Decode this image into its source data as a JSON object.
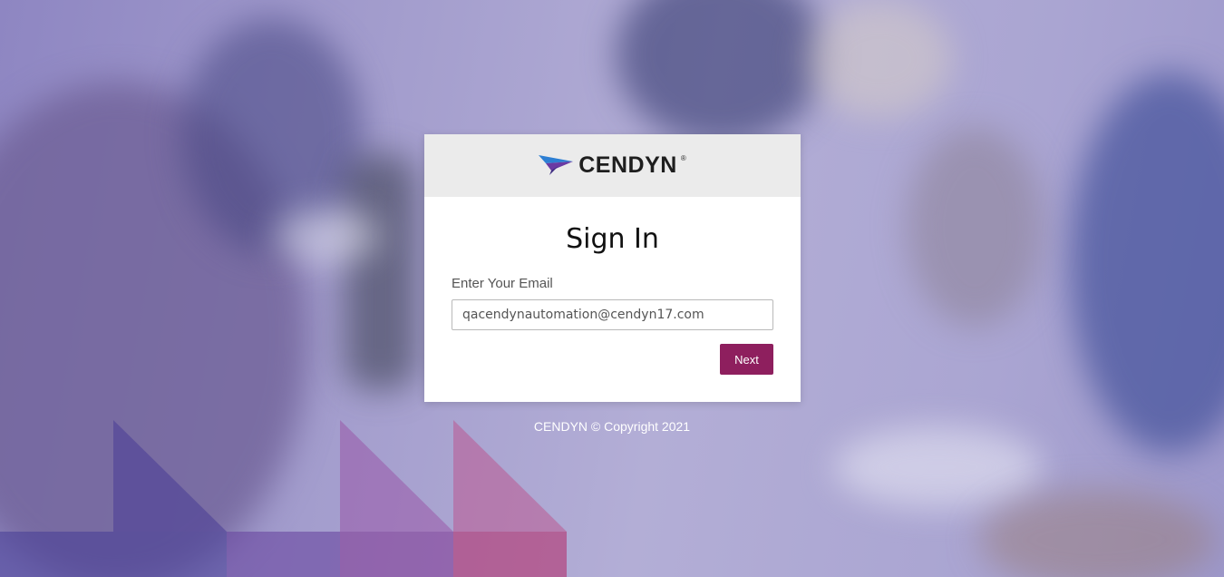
{
  "brand": {
    "name": "CENDYN",
    "registered_mark": "®",
    "accent_color": "#8e1f5e"
  },
  "signin": {
    "title": "Sign In",
    "email_label": "Enter Your Email",
    "email_value": "qacendynautomation@cendyn17.com",
    "next_label": "Next"
  },
  "footer": {
    "copyright": "CENDYN © Copyright 2021"
  },
  "icons": {
    "logo_mark": "cendyn-bird-logo-icon"
  }
}
